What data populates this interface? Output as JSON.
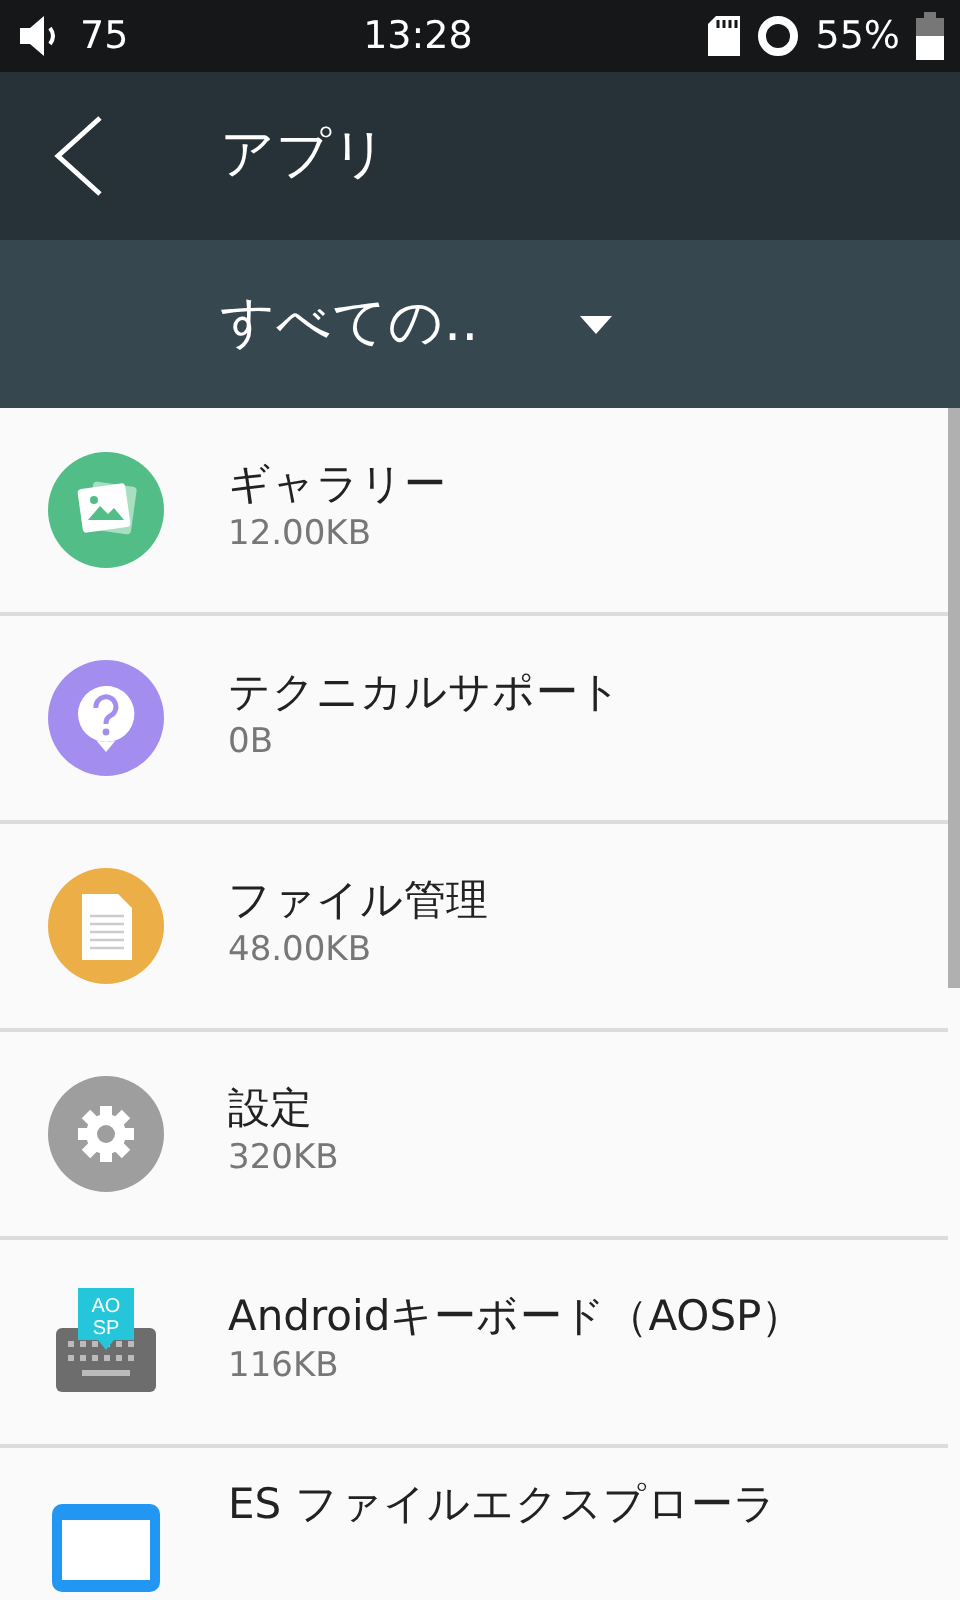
{
  "status_bar": {
    "volume": "75",
    "time": "13:28",
    "battery": "55%"
  },
  "app_bar": {
    "title": "アプリ"
  },
  "filter": {
    "label": "すべての.."
  },
  "apps": [
    {
      "kind": "gallery",
      "name": "ギャラリー",
      "size": "12.00KB"
    },
    {
      "kind": "support",
      "name": "テクニカルサポート",
      "size": "0B"
    },
    {
      "kind": "files",
      "name": "ファイル管理",
      "size": "48.00KB"
    },
    {
      "kind": "settings",
      "name": "設定",
      "size": "320KB"
    },
    {
      "kind": "keyboard",
      "name": "Androidキーボード（AOSP）",
      "size": "116KB",
      "icon_text": [
        "AO",
        "SP"
      ]
    },
    {
      "kind": "explorer",
      "name": "ES ファイルエクスプローラ"
    }
  ]
}
